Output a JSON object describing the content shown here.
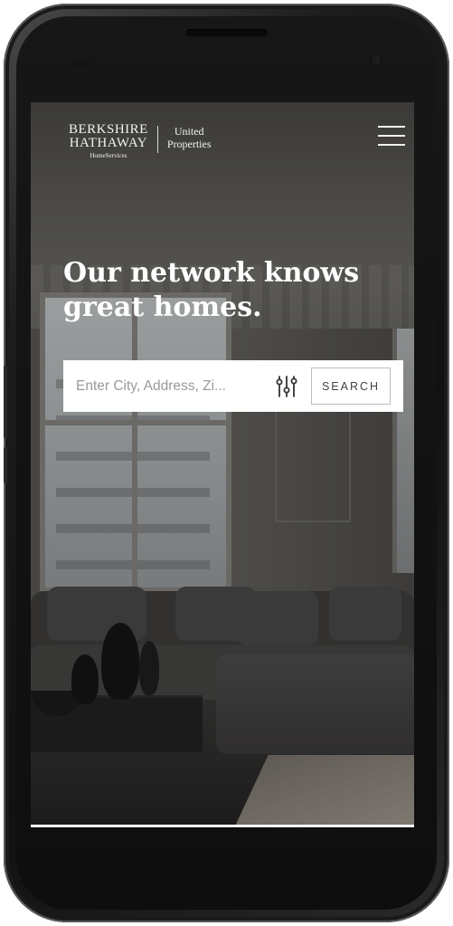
{
  "header": {
    "logo": {
      "brand_line1": "BERKSHIRE",
      "brand_line2": "HATHAWAY",
      "brand_line3": "HomeServices",
      "affiliate_line1": "United",
      "affiliate_line2": "Properties"
    },
    "menu_icon": "hamburger-menu-icon"
  },
  "hero": {
    "title_line1": "Our network knows",
    "title_line2": "great homes."
  },
  "search": {
    "placeholder": "Enter City, Address, Zi...",
    "filter_icon": "filter-sliders-icon",
    "button_label": "SEARCH"
  },
  "colors": {
    "hero_text": "#ffffff",
    "search_background": "#ffffff",
    "placeholder_text": "#9a9a9a",
    "button_border": "#bdbdbd"
  }
}
